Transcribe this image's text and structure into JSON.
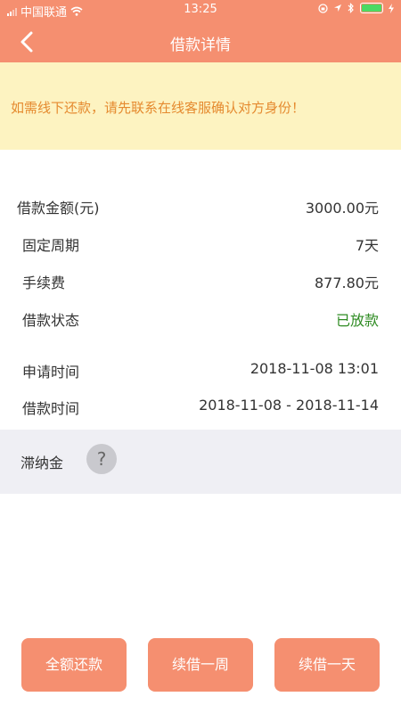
{
  "status_bar": {
    "carrier": "中国联通",
    "time": "13:25"
  },
  "header": {
    "back_icon": "chevron-left-icon",
    "title": "借款详情"
  },
  "notice": {
    "text": "如需线下还款，请先联系在线客服确认对方身份！"
  },
  "details": [
    {
      "label": "借款金额(元)",
      "value": "3000.00元"
    },
    {
      "label": "固定周期",
      "value": "7天"
    },
    {
      "label": "手续费",
      "value": "877.80元"
    },
    {
      "label": "借款状态",
      "value": "已放款",
      "value_color": "#2e8b22"
    },
    {
      "label": "申请时间",
      "value": "2018-11-08 13:01"
    },
    {
      "label": "借款时间",
      "value": "2018-11-08 - 2018-11-14"
    }
  ],
  "late_fee": {
    "label": "滞纳金",
    "help_icon": "question-mark-icon",
    "help_glyph": "?"
  },
  "actions": {
    "repay_full": "全额还款",
    "renew_week": "续借一周",
    "renew_day": "续借一天"
  },
  "colors": {
    "accent": "#f58f70",
    "notice_bg": "#fdf3c1",
    "notice_text": "#e58a2f",
    "status_green": "#2e8b22"
  }
}
